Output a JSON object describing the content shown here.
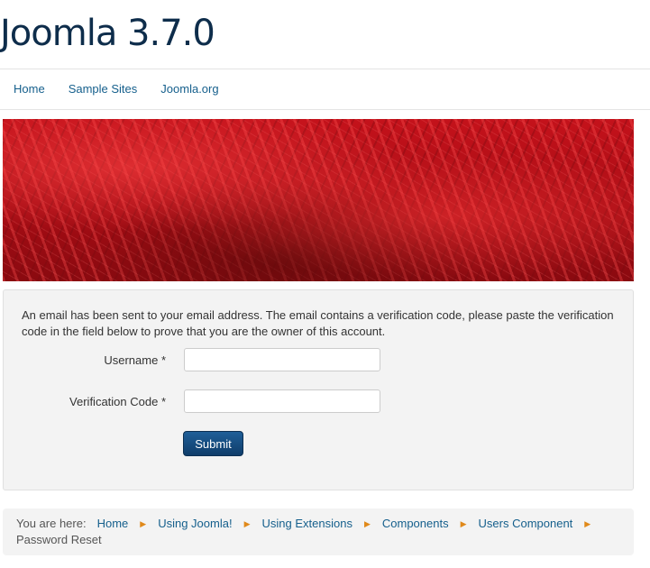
{
  "site": {
    "title": "Joomla 3.7.0"
  },
  "nav": {
    "items": [
      "Home",
      "Sample Sites",
      "Joomla.org"
    ]
  },
  "form": {
    "message": "An email has been sent to your email address. The email contains a verification code, please paste the verification code in the field below to prove that you are the owner of this account.",
    "username_label": "Username *",
    "username_value": "",
    "code_label": "Verification Code *",
    "code_value": "",
    "submit_label": "Submit"
  },
  "breadcrumb": {
    "prefix": "You are here:",
    "items": [
      "Home",
      "Using Joomla!",
      "Using Extensions",
      "Components",
      "Users Component"
    ],
    "current": "Password Reset",
    "divider_icon": "triangle-right-icon",
    "divider_color": "#e0891a"
  },
  "colors": {
    "title": "#0e2d4b",
    "link": "#155f8c",
    "button": "#17507f"
  }
}
